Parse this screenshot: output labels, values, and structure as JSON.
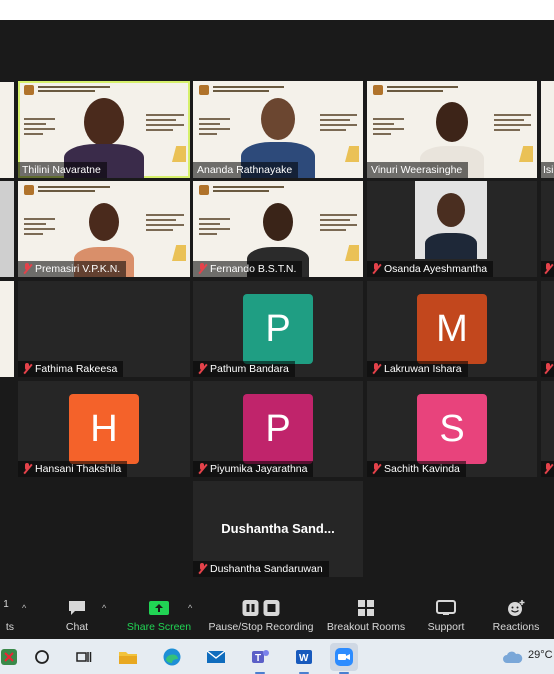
{
  "participants": [
    {
      "name": "Thilini Navaratne",
      "muted": false,
      "active": true
    },
    {
      "name": "Ananda Rathnayake",
      "muted": false
    },
    {
      "name": "Vinuri Weerasinghe",
      "muted": false
    },
    {
      "name": "Isi"
    },
    {
      "name": "Premasiri V.P.K.N.",
      "muted": true
    },
    {
      "name": "Fernando B.S.T.N.",
      "muted": true
    },
    {
      "name": "Osanda Ayeshmantha",
      "muted": true
    },
    {
      "name": "Fathima Rakeesa",
      "muted": true
    },
    {
      "name": "Pathum Bandara",
      "muted": true,
      "initial": "P",
      "color": "#1f9e83"
    },
    {
      "name": "Lakruwan Ishara",
      "muted": true,
      "initial": "M",
      "color": "#c2471d"
    },
    {
      "name": "Hansani Thakshila",
      "muted": true,
      "initial": "H",
      "color": "#f4622a"
    },
    {
      "name": "Piyumika Jayarathna",
      "muted": true,
      "initial": "P",
      "color": "#c0246b"
    },
    {
      "name": "Sachith Kavinda",
      "muted": true,
      "initial": "S",
      "color": "#e8437c"
    },
    {
      "name": "Dushantha Sandaruwan",
      "muted": true,
      "display_title": "Dushantha  Sand..."
    }
  ],
  "toolbar": {
    "participants_count": "1",
    "participants_label": "ts",
    "chat": "Chat",
    "share_screen": "Share Screen",
    "pause_recording": "Pause/Stop Recording",
    "breakout_rooms": "Breakout Rooms",
    "support": "Support",
    "reactions": "Reactions"
  },
  "taskbar": {
    "weather_temp": "29°C",
    "apps": [
      "windows",
      "search",
      "task-view",
      "file-explorer",
      "edge",
      "mail",
      "teams",
      "word",
      "zoom"
    ]
  },
  "colors": {
    "share_green": "#21d454",
    "mute_red": "#e4424a",
    "active_border": "#d6f06b"
  }
}
